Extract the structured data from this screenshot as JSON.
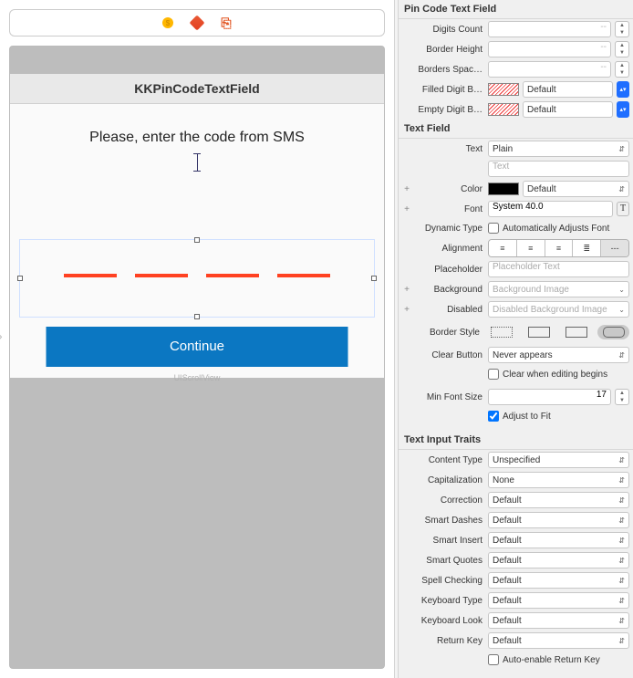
{
  "toolbar": {
    "icon1": "●",
    "icon2": "◆",
    "icon3": "↪"
  },
  "view": {
    "title": "KKPinCodeTextField",
    "subtitle": "Please, enter the code from SMS",
    "continue": "Continue",
    "watermark": "UIScrollView"
  },
  "sections": {
    "pinCode": "Pin Code Text Field",
    "textField": "Text Field",
    "traits": "Text Input Traits"
  },
  "pin": {
    "digitsCount_lbl": "Digits Count",
    "digitsCount": "--",
    "borderHeight_lbl": "Border Height",
    "borderHeight": "--",
    "bordersSpace_lbl": "Borders Spac…",
    "bordersSpace": "--",
    "filled_lbl": "Filled Digit B…",
    "filled": "Default",
    "empty_lbl": "Empty Digit B…",
    "empty": "Default"
  },
  "tf": {
    "text_lbl": "Text",
    "text": "Plain",
    "text_ph": "Text",
    "color_lbl": "Color",
    "color": "Default",
    "font_lbl": "Font",
    "font": "System 40.0",
    "dynamic_lbl": "Dynamic Type",
    "dynamic": "Automatically Adjusts Font",
    "align_lbl": "Alignment",
    "placeholder_lbl": "Placeholder",
    "placeholder_ph": "Placeholder Text",
    "background_lbl": "Background",
    "background_ph": "Background Image",
    "disabled_lbl": "Disabled",
    "disabled_ph": "Disabled Background Image",
    "border_lbl": "Border Style",
    "clear_lbl": "Clear Button",
    "clear": "Never appears",
    "clearEditing": "Clear when editing begins",
    "minFont_lbl": "Min Font Size",
    "minFont": "17",
    "adjust": "Adjust to Fit"
  },
  "traits": {
    "contentType_lbl": "Content Type",
    "contentType": "Unspecified",
    "capitalization_lbl": "Capitalization",
    "capitalization": "None",
    "correction_lbl": "Correction",
    "correction": "Default",
    "smartDashes_lbl": "Smart Dashes",
    "smartDashes": "Default",
    "smartInsert_lbl": "Smart Insert",
    "smartInsert": "Default",
    "smartQuotes_lbl": "Smart Quotes",
    "smartQuotes": "Default",
    "spellCheck_lbl": "Spell Checking",
    "spellCheck": "Default",
    "keyboardType_lbl": "Keyboard Type",
    "keyboardType": "Default",
    "keyboardLook_lbl": "Keyboard Look",
    "keyboardLook": "Default",
    "returnKey_lbl": "Return Key",
    "returnKey": "Default",
    "autoReturn": "Auto-enable Return Key"
  }
}
